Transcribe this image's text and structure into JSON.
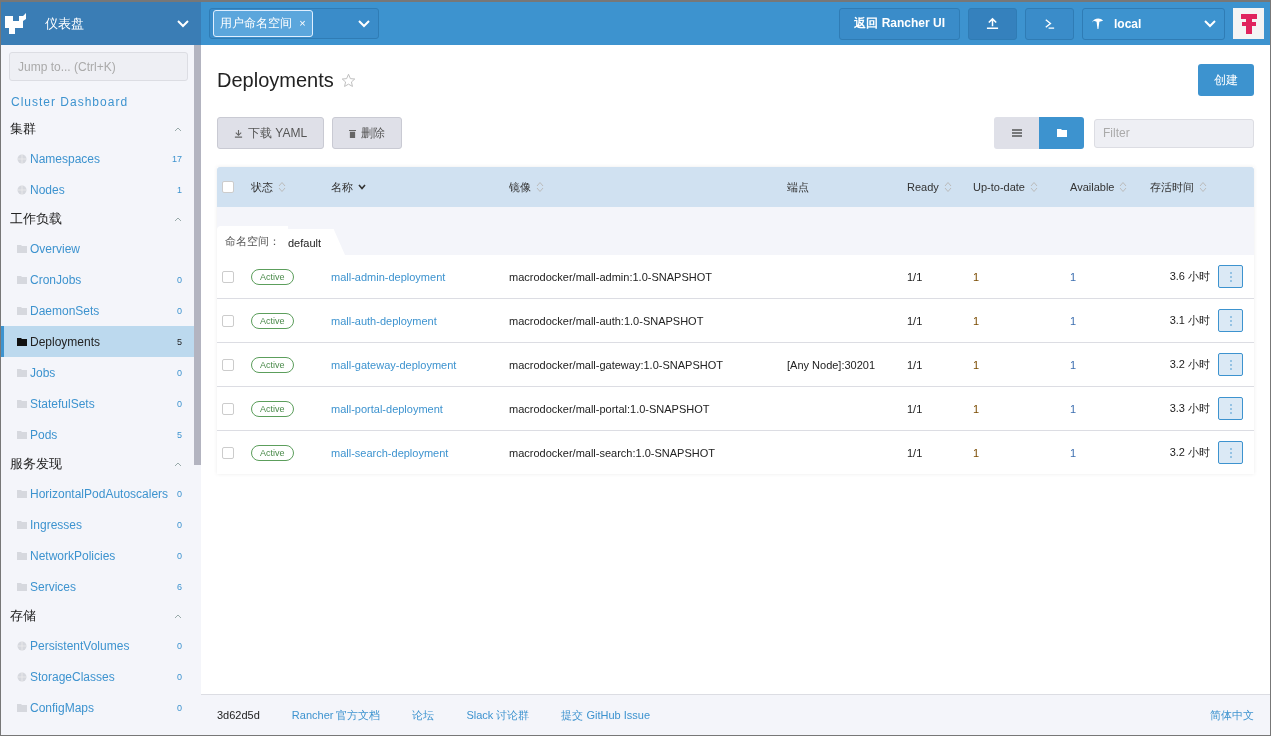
{
  "header": {
    "product": "仪表盘",
    "namespace_chip": "用户命名空间",
    "chip_remove": "×",
    "back_button": "返回 Rancher UI",
    "cluster": "local"
  },
  "sidebar": {
    "jump_placeholder": "Jump to... (Ctrl+K)",
    "dashboard_link": "Cluster Dashboard",
    "groups": [
      {
        "title": "集群",
        "expanded": true,
        "items": [
          {
            "label": "Namespaces",
            "count": "17",
            "kind": "globe",
            "selected": false
          },
          {
            "label": "Nodes",
            "count": "1",
            "kind": "globe",
            "selected": false
          }
        ]
      },
      {
        "title": "工作负载",
        "expanded": true,
        "items": [
          {
            "label": "Overview",
            "kind": "folder",
            "selected": false
          },
          {
            "label": "CronJobs",
            "count": "0",
            "kind": "folder",
            "selected": false
          },
          {
            "label": "DaemonSets",
            "count": "0",
            "kind": "folder",
            "selected": false
          },
          {
            "label": "Deployments",
            "count": "5",
            "kind": "folder",
            "selected": true
          },
          {
            "label": "Jobs",
            "count": "0",
            "kind": "folder",
            "selected": false
          },
          {
            "label": "StatefulSets",
            "count": "0",
            "kind": "folder",
            "selected": false
          },
          {
            "label": "Pods",
            "count": "5",
            "kind": "folder",
            "selected": false
          }
        ]
      },
      {
        "title": "服务发现",
        "expanded": true,
        "items": [
          {
            "label": "HorizontalPodAutoscalers",
            "count": "0",
            "kind": "folder",
            "selected": false
          },
          {
            "label": "Ingresses",
            "count": "0",
            "kind": "folder",
            "selected": false
          },
          {
            "label": "NetworkPolicies",
            "count": "0",
            "kind": "folder",
            "selected": false
          },
          {
            "label": "Services",
            "count": "6",
            "kind": "folder",
            "selected": false
          }
        ]
      },
      {
        "title": "存储",
        "expanded": true,
        "items": [
          {
            "label": "PersistentVolumes",
            "count": "0",
            "kind": "globe",
            "selected": false
          },
          {
            "label": "StorageClasses",
            "count": "0",
            "kind": "globe",
            "selected": false
          },
          {
            "label": "ConfigMaps",
            "count": "0",
            "kind": "folder",
            "selected": false
          }
        ]
      }
    ]
  },
  "page": {
    "title": "Deployments",
    "favorite": false,
    "create_button": "创建",
    "download_button": "下载 YAML",
    "delete_button": "删除",
    "view_modes": [
      {
        "kind": "list",
        "selected": false
      },
      {
        "kind": "folder",
        "selected": true
      }
    ],
    "filter_placeholder": "Filter"
  },
  "table": {
    "select_all_checked": false,
    "columns": [
      {
        "label": "状态",
        "sortable": true,
        "sorted": false
      },
      {
        "label": "名称",
        "sortable": true,
        "sorted": true
      },
      {
        "label": "镜像",
        "sortable": true,
        "sorted": false
      },
      {
        "label": "端点",
        "sortable": false,
        "sorted": false
      },
      {
        "label": "Ready",
        "sortable": true,
        "sorted": false
      },
      {
        "label": "Up-to-date",
        "sortable": true,
        "sorted": false
      },
      {
        "label": "Available",
        "sortable": true,
        "sorted": false
      },
      {
        "label": "存活时间",
        "sortable": true,
        "sorted": false
      }
    ],
    "group_label": "命名空间：",
    "group_value": "default",
    "rows": [
      {
        "state": "Active",
        "name": "mall-admin-deployment",
        "image": "macrodocker/mall-admin:1.0-SNAPSHOT",
        "ready": "1/1",
        "up_to_date": "1",
        "available": "1",
        "age": "3.6 小时",
        "checked": false
      },
      {
        "state": "Active",
        "name": "mall-auth-deployment",
        "image": "macrodocker/mall-auth:1.0-SNAPSHOT",
        "ready": "1/1",
        "up_to_date": "1",
        "available": "1",
        "age": "3.1 小时",
        "checked": false
      },
      {
        "state": "Active",
        "name": "mall-gateway-deployment",
        "image": "macrodocker/mall-gateway:1.0-SNAPSHOT",
        "endpoint": "[Any Node]:30201",
        "ready": "1/1",
        "up_to_date": "1",
        "available": "1",
        "age": "3.2 小时",
        "checked": false
      },
      {
        "state": "Active",
        "name": "mall-portal-deployment",
        "image": "macrodocker/mall-portal:1.0-SNAPSHOT",
        "ready": "1/1",
        "up_to_date": "1",
        "available": "1",
        "age": "3.3 小时",
        "checked": false
      },
      {
        "state": "Active",
        "name": "mall-search-deployment",
        "image": "macrodocker/mall-search:1.0-SNAPSHOT",
        "ready": "1/1",
        "up_to_date": "1",
        "available": "1",
        "age": "3.2 小时",
        "checked": false
      }
    ]
  },
  "footer": {
    "version": "3d62d5d",
    "links": [
      "Rancher 官方文档",
      "论坛",
      "Slack 讨论群",
      "提交 GitHub Issue"
    ],
    "language": "简体中文"
  }
}
